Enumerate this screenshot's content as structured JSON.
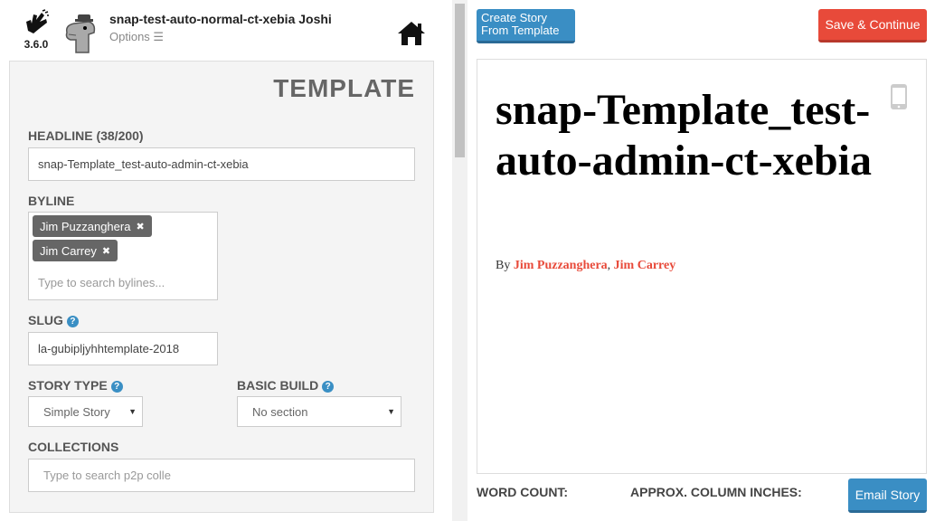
{
  "header": {
    "version": "3.6.0",
    "title": "snap-test-auto-normal-ct-xebia Joshi",
    "options_label": "Options ☰"
  },
  "template": {
    "heading": "TEMPLATE",
    "headline_label": "HEADLINE (38/200)",
    "headline_value": "snap-Template_test-auto-admin-ct-xebia",
    "byline_label": "BYLINE",
    "bylines": [
      "Jim Puzzanghera",
      "Jim Carrey"
    ],
    "byline_placeholder": "Type to search bylines...",
    "slug_label": "SLUG",
    "slug_value": "la-gubipljyhhtemplate-2018",
    "story_type_label": "STORY TYPE",
    "story_type_value": "Simple Story",
    "basic_build_label": "BASIC BUILD",
    "basic_build_value": "No section",
    "collections_label": "COLLECTIONS",
    "collections_placeholder": "Type to search p2p colle"
  },
  "actions": {
    "create_line1": "Create Story",
    "create_line2": "From Template",
    "save_label": "Save & Continue",
    "email_label": "Email Story"
  },
  "preview": {
    "headline": "snap-Template_test-auto-admin-ct-xebia",
    "by_prefix": "By",
    "author1": "Jim Puzzanghera",
    "separator": ",",
    "author2": "Jim Carrey"
  },
  "footer": {
    "word_count_label": "WORD COUNT:",
    "column_inches_label": "APPROX. COLUMN INCHES:"
  },
  "colors": {
    "blue": "#3a8ec4",
    "red": "#e84a3a"
  }
}
